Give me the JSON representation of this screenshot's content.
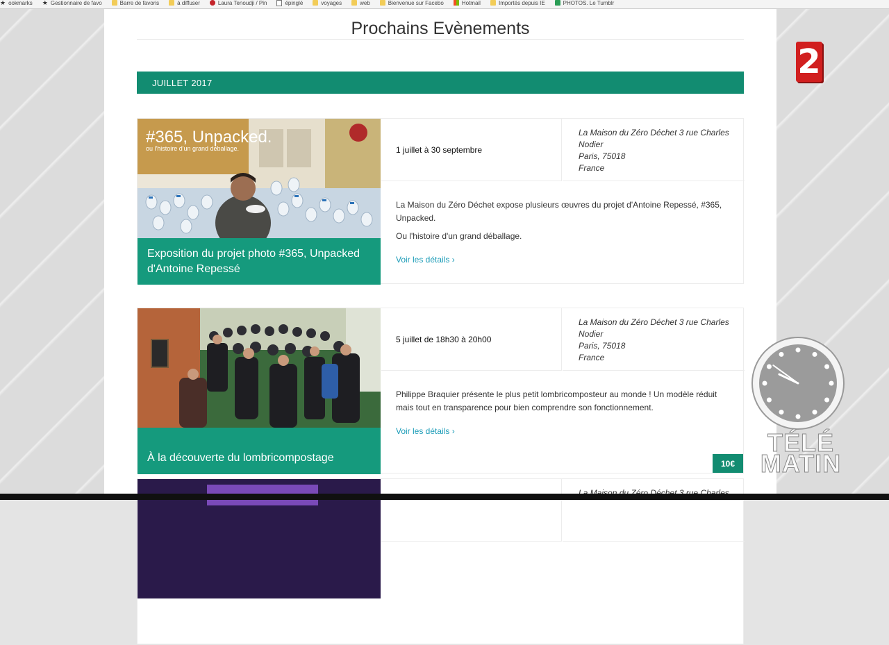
{
  "bookmarks": [
    {
      "label": "ookmarks",
      "icon": "star-icon"
    },
    {
      "label": "Gestionnaire de favo",
      "icon": "star-icon"
    },
    {
      "label": "Barre de favoris",
      "icon": "folder-icon"
    },
    {
      "label": "à diffuser",
      "icon": "folder-icon"
    },
    {
      "label": "Laura Tenoudji / Pin",
      "icon": "pinterest-icon"
    },
    {
      "label": "épinglé",
      "icon": "document-icon"
    },
    {
      "label": "voyages",
      "icon": "folder-icon"
    },
    {
      "label": "web",
      "icon": "folder-icon"
    },
    {
      "label": "Bienvenue sur Facebo",
      "icon": "folder-icon"
    },
    {
      "label": "Hotmail",
      "icon": "microsoft-icon"
    },
    {
      "label": "Importés depuis IE",
      "icon": "folder-icon"
    },
    {
      "label": "PHOTOS. Le Tumblr",
      "icon": "camera-icon"
    }
  ],
  "page": {
    "title": "Prochains Evènements",
    "month": "JUILLET 2017"
  },
  "events": [
    {
      "photo_title": "#365, Unpacked.",
      "photo_subtitle": "ou l'histoire d'un grand déballage.",
      "caption": "Exposition du projet photo #365, Unpacked d'Antoine Repessé",
      "date": "1 juillet à 30 septembre",
      "location": [
        "La Maison du Zéro Déchet 3 rue Charles",
        "Nodier",
        "Paris, 75018",
        "France"
      ],
      "description": [
        "La Maison du Zéro Déchet expose plusieurs œuvres du projet d'Antoine Repessé, #365, Unpacked.",
        "Ou l'histoire d'un grand déballage."
      ],
      "link": "Voir les détails ›"
    },
    {
      "caption": "À la découverte du lombricompostage",
      "date": "5 juillet de 18h30 à 20h00",
      "location": [
        "La Maison du Zéro Déchet 3 rue Charles",
        "Nodier",
        "Paris, 75018",
        "France"
      ],
      "description": [
        "Philippe Braquier présente le plus petit lombricomposteur au monde ! Un modèle réduit mais tout en transparence pour bien comprendre son fonctionnement."
      ],
      "link": "Voir les détails ›",
      "price": "10€"
    },
    {
      "location": [
        "La Maison du Zéro Déchet 3 rue Charles"
      ]
    }
  ],
  "tv": {
    "channel": "2",
    "show_line1": "TÉLÉ",
    "show_line2": "MATIN",
    "clock_time": "09:51"
  },
  "colors": {
    "accent": "#128c71",
    "caption": "#159a7d",
    "link": "#1a9bb7",
    "channel": "#d11f1f"
  }
}
